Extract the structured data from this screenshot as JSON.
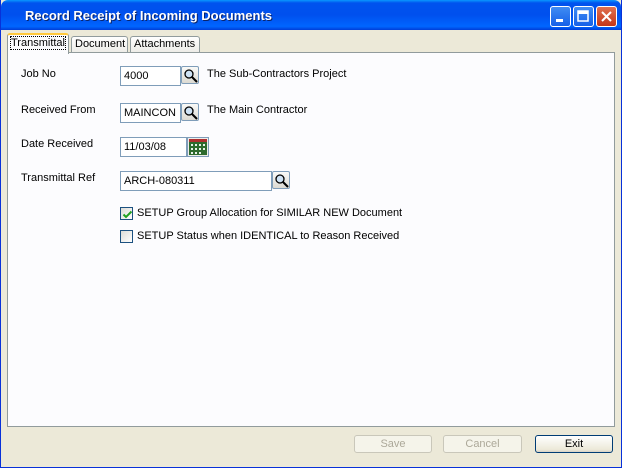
{
  "window": {
    "title": "Record Receipt of Incoming Documents"
  },
  "tabs": [
    {
      "label": "Transmittal",
      "active": true
    },
    {
      "label": "Document",
      "active": false
    },
    {
      "label": "Attachments",
      "active": false
    }
  ],
  "form": {
    "job_no": {
      "label": "Job No",
      "value": "4000",
      "description": "The Sub-Contractors Project"
    },
    "received_from": {
      "label": "Received From",
      "value": "MAINCON",
      "description": "The Main Contractor"
    },
    "date_received": {
      "label": "Date Received",
      "value": "11/03/08"
    },
    "transmittal_ref": {
      "label": "Transmittal Ref",
      "value": "ARCH-080311"
    },
    "checkbox_group_allocation": {
      "label": "SETUP Group Allocation for SIMILAR NEW Document",
      "checked": true
    },
    "checkbox_status": {
      "label": "SETUP Status when IDENTICAL to Reason Received",
      "checked": false
    }
  },
  "buttons": {
    "save": "Save",
    "cancel": "Cancel",
    "exit": "Exit"
  },
  "icons": [
    "window-icon",
    "minimize-icon",
    "maximize-icon",
    "close-icon",
    "lookup-icon",
    "calendar-icon",
    "checkmark-icon"
  ],
  "colors": {
    "titlebar": "#0054e3",
    "tab_highlight": "#ffc83c",
    "panel": "#fcfcfe",
    "window_bg": "#ece9d8",
    "close_button": "#d6451f"
  }
}
